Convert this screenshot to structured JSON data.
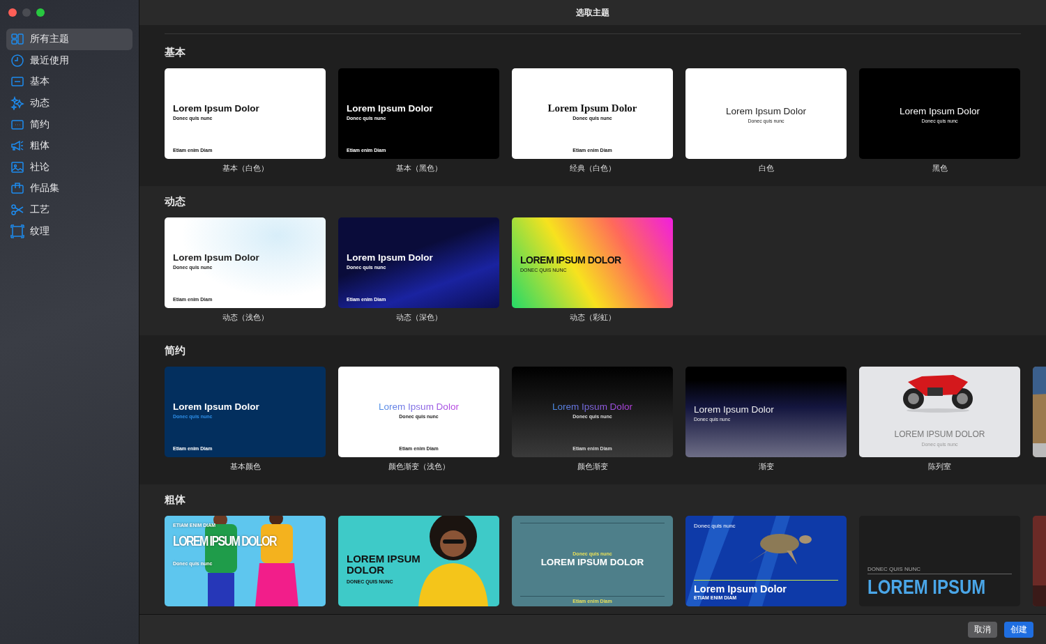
{
  "window": {
    "title": "选取主题"
  },
  "sidebar": {
    "items": [
      {
        "label": "所有主题",
        "selected": true
      },
      {
        "label": "最近使用",
        "selected": false
      },
      {
        "label": "基本",
        "selected": false
      },
      {
        "label": "动态",
        "selected": false
      },
      {
        "label": "简约",
        "selected": false
      },
      {
        "label": "粗体",
        "selected": false
      },
      {
        "label": "社论",
        "selected": false
      },
      {
        "label": "作品集",
        "selected": false
      },
      {
        "label": "工艺",
        "selected": false
      },
      {
        "label": "纹理",
        "selected": false
      }
    ]
  },
  "sections": [
    {
      "heading": "基本",
      "themes": [
        {
          "title": "Lorem Ipsum Dolor",
          "subtitle": "Donec quis nunc",
          "footer": "Etiam enim Diam",
          "label": "基本（白色）"
        },
        {
          "title": "Lorem Ipsum Dolor",
          "subtitle": "Donec quis nunc",
          "footer": "Etiam enim Diam",
          "label": "基本（黑色）"
        },
        {
          "title": "Lorem Ipsum Dolor",
          "subtitle": "Donec quis nunc",
          "footer": "Etiam enim Diam",
          "label": "经典（白色）"
        },
        {
          "title": "Lorem Ipsum Dolor",
          "subtitle": "Donec quis nunc",
          "label": "白色"
        },
        {
          "title": "Lorem Ipsum Dolor",
          "subtitle": "Donec quis nunc",
          "label": "黑色"
        }
      ]
    },
    {
      "heading": "动态",
      "themes": [
        {
          "title": "Lorem Ipsum Dolor",
          "subtitle": "Donec quis nunc",
          "footer": "Etiam enim Diam",
          "label": "动态（浅色）"
        },
        {
          "title": "Lorem Ipsum Dolor",
          "subtitle": "Donec quis nunc",
          "footer": "Etiam enim Diam",
          "label": "动态（深色）"
        },
        {
          "title": "LOREM IPSUM DOLOR",
          "subtitle": "DONEC QUIS NUNC",
          "label": "动态（彩虹）"
        }
      ]
    },
    {
      "heading": "简约",
      "themes": [
        {
          "title": "Lorem Ipsum Dolor",
          "subtitle": "Donec quis nunc",
          "footer": "Etiam enim Diam",
          "label": "基本颜色"
        },
        {
          "title": "Lorem Ipsum Dolor",
          "subtitle": "Donec quis nunc",
          "footer": "Etiam enim Diam",
          "label": "颜色渐变（浅色）"
        },
        {
          "title": "Lorem Ipsum Dolor",
          "subtitle": "Donec quis nunc",
          "footer": "Etiam enim Diam",
          "label": "颜色渐变"
        },
        {
          "title": "Lorem Ipsum Dolor",
          "subtitle": "Donec quis nunc",
          "label": "渐变"
        },
        {
          "kind": "picture",
          "title": "LOREM IPSUM DOLOR",
          "subtitle": "Donec quis nunc",
          "label": "陈列室"
        },
        {
          "kind": "picture"
        }
      ]
    },
    {
      "heading": "粗体",
      "themes": [
        {
          "kind": "picture",
          "eyebrow": "ETIAM ENIM DIAM",
          "title": "LOREM IPSUM DOLOR",
          "subtitle": "Donec quis nunc"
        },
        {
          "kind": "picture",
          "title": "LOREM IPSUM DOLOR",
          "subtitle": "DONEC QUIS NUNC"
        },
        {
          "eyebrow": "Donec quis nunc",
          "title": "LOREM IPSUM DOLOR",
          "footer": "Etiam enim Diam"
        },
        {
          "kind": "picture",
          "eyebrow": "Donec quis nunc",
          "title": "Lorem Ipsum Dolor",
          "footer": "ETIAM ENIM DIAM"
        },
        {
          "eyebrow": "DONEC QUIS NUNC",
          "title": "LOREM IPSUM"
        },
        {
          "kind": "picture"
        }
      ]
    }
  ],
  "buttons": [
    {
      "label": "取消",
      "kind": "secondary"
    },
    {
      "label": "创建",
      "kind": "primary"
    }
  ]
}
